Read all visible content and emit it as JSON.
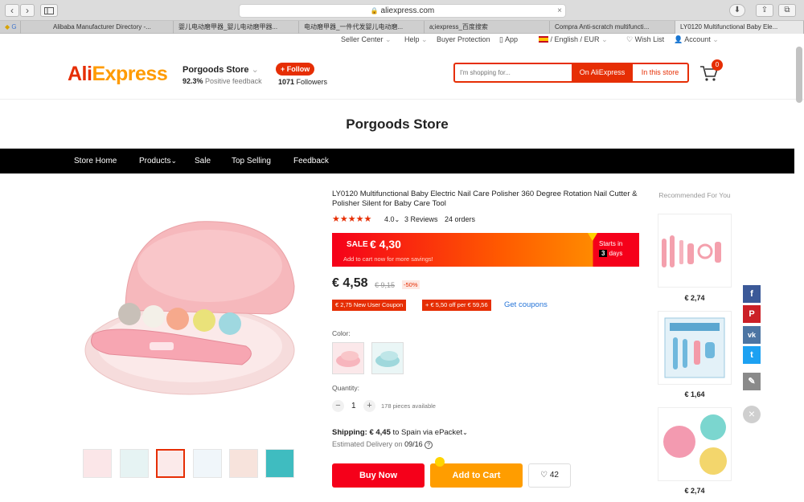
{
  "browser": {
    "url": "aliexpress.com",
    "back_glyph": "‹",
    "forward_glyph": "›",
    "tabs": [
      "Alibaba Manufacturer Directory -...",
      "婴儿电动磨甲器_婴儿电动磨甲器...",
      "电动磨甲器_一件代发婴儿电动磨...",
      "a;iexpress_百度搜索",
      "Compra Anti-scratch multifuncti...",
      "LY0120 Multifunctional Baby Ele..."
    ]
  },
  "utility": {
    "seller_center": "Seller Center",
    "help": "Help",
    "buyer_protection": "Buyer Protection",
    "app": "App",
    "lang_currency": "/ English / EUR",
    "wish_list": "Wish List",
    "account": "Account"
  },
  "header": {
    "logo_a": "Ali",
    "logo_b": "Express",
    "store_name": "Porgoods Store",
    "feedback_pct": "92.3%",
    "feedback_text": "Positive feedback",
    "follow_label": "+ Follow",
    "followers_count": "1071",
    "followers_label": "Followers",
    "search_placeholder": "I'm shopping for...",
    "btn_ali": "On AliExpress",
    "btn_store": "In this store",
    "cart_count": "0"
  },
  "store_title": "Porgoods Store",
  "nav": {
    "home": "Store Home",
    "products": "Products",
    "sale": "Sale",
    "top_selling": "Top Selling",
    "feedback": "Feedback"
  },
  "product": {
    "title": "LY0120 Multifunctional Baby Electric Nail Care Polisher 360 Degree Rotation Nail Cutter & Polisher Silent for Baby Care Tool",
    "stars": "★★★★★",
    "rating": "4.0",
    "reviews": "3 Reviews",
    "orders": "24 orders",
    "sale_label": "SALE",
    "sale_price": "€ 4,30",
    "sale_note": "Add to cart now for more savings!",
    "starts_in": "Starts in",
    "starts_days_n": "3",
    "starts_days_unit": "days",
    "price": "€ 4,58",
    "old_price": "€ 9,15",
    "discount": "-50%",
    "coupon1": "€ 2,75 New User Coupon",
    "coupon2": "+ € 5,50 off per € 59,56",
    "get_coupons": "Get coupons",
    "color_label": "Color:",
    "quantity_label": "Quantity:",
    "qty": "1",
    "qty_avail": "178 pieces available",
    "shipping_label": "Shipping:",
    "shipping_price": "€ 4,45",
    "shipping_rest": "to Spain via ePacket",
    "delivery_label": "Estimated Delivery on",
    "delivery_date": "09/16",
    "buy_now": "Buy Now",
    "add_to_cart": "Add to Cart",
    "wish_count": "42"
  },
  "recommend": {
    "title": "Recommended For You",
    "items": [
      {
        "price": "€ 2,74"
      },
      {
        "price": "€ 1,64"
      },
      {
        "price": "€ 2,74"
      }
    ]
  },
  "social": {
    "facebook": "f",
    "pinterest": "P",
    "vk": "vk",
    "twitter": "t",
    "close": "×"
  },
  "colors": {
    "brand_red": "#e62e04",
    "orange": "#ff9d00",
    "link_blue": "#2574d8"
  }
}
